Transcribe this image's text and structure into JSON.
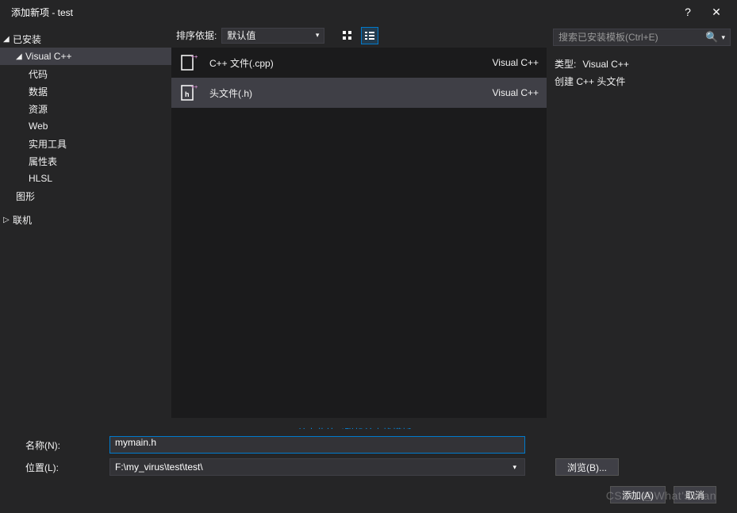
{
  "titlebar": {
    "title": "添加新项 - test",
    "help": "?",
    "close": "✕"
  },
  "tree": {
    "installed": "已安装",
    "vcpp": "Visual C++",
    "children": [
      "代码",
      "数据",
      "资源",
      "Web",
      "实用工具",
      "属性表",
      "HLSL"
    ],
    "graphics": "图形",
    "online": "联机"
  },
  "sortbar": {
    "label": "排序依据:",
    "selected": "默认值"
  },
  "templates": [
    {
      "name": "C++ 文件(.cpp)",
      "lang": "Visual C++",
      "icon": "cpp"
    },
    {
      "name": "头文件(.h)",
      "lang": "Visual C++",
      "icon": "h"
    }
  ],
  "link": "单击此处以联机并查找模板。",
  "search": {
    "placeholder": "搜索已安装模板(Ctrl+E)"
  },
  "detail": {
    "type_label": "类型:",
    "type_value": "Visual C++",
    "desc": "创建 C++ 头文件"
  },
  "form": {
    "name_label": "名称(N):",
    "name_value": "mymain.h",
    "loc_label": "位置(L):",
    "loc_value": "F:\\my_virus\\test\\test\\",
    "browse": "浏览(B)...",
    "add": "添加(A)",
    "cancel": "取消"
  },
  "watermark": "CSDN @What's man"
}
